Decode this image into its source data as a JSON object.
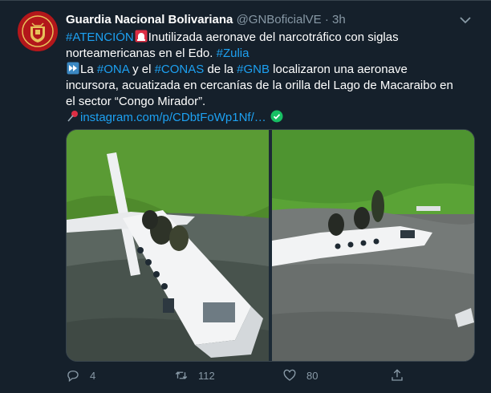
{
  "tweet": {
    "author_name": "Guardia Nacional Bolivariana",
    "handle": "@GNBoficialVE",
    "separator": "·",
    "time": "3h",
    "line1_tag": "#ATENCIÓN",
    "line1_text": "Inutilizada aeronave del narcotráfico con siglas norteamericanas en el Edo.",
    "line1_tag2": "#Zulia",
    "p2_a": "La",
    "p2_tag_ona": "#ONA",
    "p2_b": "y el",
    "p2_tag_conas": "#CONAS",
    "p2_c": "de la",
    "p2_tag_gnb": "#GNB",
    "p2_d": "localizaron una aeronave incursora, acuatizada en cercanías de la orilla del Lago de Macaraibo en el sector “Congo Mirador”.",
    "link": "instagram.com/p/CDbtFoWp1Nf/…"
  },
  "actions": {
    "reply_count": "4",
    "retweet_count": "112",
    "like_count": "80"
  },
  "icons": {
    "avatar": "gnb-emblem",
    "more": "chevron-down-icon",
    "siren": "rotating-light-icon",
    "fast_forward": "fast-forward-icon",
    "pin": "pushpin-icon",
    "check": "check-circle-icon",
    "reply": "reply-icon",
    "retweet": "retweet-icon",
    "like": "heart-icon",
    "share": "share-icon"
  },
  "colors": {
    "background": "#15202b",
    "link": "#1da1f2",
    "muted": "#8899a6"
  }
}
